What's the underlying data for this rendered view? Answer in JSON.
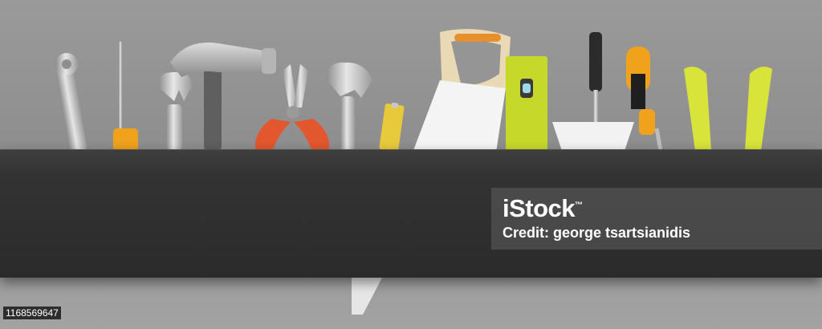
{
  "image": {
    "watermark": {
      "logo": "iStock",
      "trademark": "™",
      "credit": "Credit: george tsartsianidis"
    },
    "image_id": "1168569647",
    "background_color": "#959595",
    "panel_color": "#303030"
  },
  "tools": [
    {
      "name": "combination-spanner",
      "icon": "spanner-icon"
    },
    {
      "name": "flathead-screwdriver",
      "icon": "screwdriver-icon"
    },
    {
      "name": "open-end-wrench",
      "icon": "wrench-icon"
    },
    {
      "name": "claw-hammer",
      "icon": "hammer-icon"
    },
    {
      "name": "combination-pliers",
      "icon": "pliers-icon"
    },
    {
      "name": "adjustable-wrench",
      "icon": "adjustable-wrench-icon"
    },
    {
      "name": "tape-measure",
      "icon": "tape-measure-icon"
    },
    {
      "name": "hand-saw",
      "icon": "saw-icon"
    },
    {
      "name": "spirit-level",
      "icon": "level-icon"
    },
    {
      "name": "trowel",
      "icon": "trowel-icon"
    },
    {
      "name": "screwdriver",
      "icon": "screwdriver-icon"
    },
    {
      "name": "pliers",
      "icon": "pliers-icon"
    }
  ]
}
